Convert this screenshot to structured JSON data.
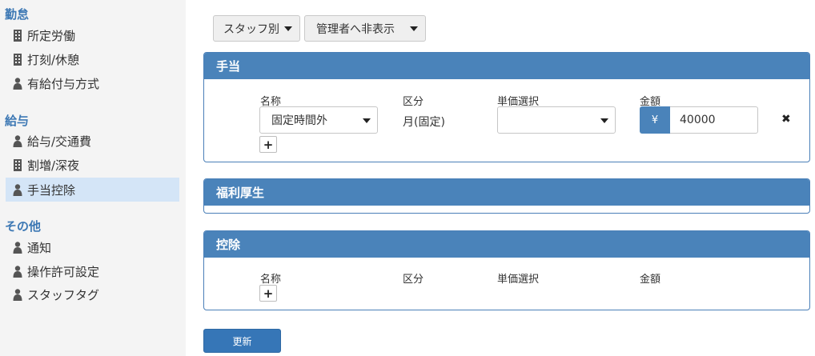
{
  "sidebar": {
    "sections": [
      {
        "title": "勤怠",
        "items": [
          {
            "label": "所定労働",
            "icon": "building-icon"
          },
          {
            "label": "打刻/休憩",
            "icon": "building-icon"
          },
          {
            "label": "有給付与方式",
            "icon": "user-icon"
          }
        ]
      },
      {
        "title": "給与",
        "items": [
          {
            "label": "給与/交通費",
            "icon": "user-icon"
          },
          {
            "label": "割増/深夜",
            "icon": "building-icon"
          },
          {
            "label": "手当控除",
            "icon": "user-icon",
            "active": true
          }
        ]
      },
      {
        "title": "その他",
        "items": [
          {
            "label": "通知",
            "icon": "user-icon"
          },
          {
            "label": "操作許可設定",
            "icon": "user-icon"
          },
          {
            "label": "スタッフタグ",
            "icon": "user-icon"
          }
        ]
      }
    ]
  },
  "toolbar": {
    "staff_select": "スタッフ別",
    "visibility_select": "管理者へ非表示"
  },
  "allowance": {
    "title": "手当",
    "columns": {
      "name": "名称",
      "category": "区分",
      "unit_price": "単価選択",
      "amount": "金額"
    },
    "row": {
      "name_value": "固定時間外",
      "category_value": "月(固定)",
      "unit_price_value": "",
      "currency": "¥",
      "amount_value": "40000",
      "remove": "✖"
    },
    "add": "+"
  },
  "welfare": {
    "title": "福利厚生"
  },
  "deduction": {
    "title": "控除",
    "columns": {
      "name": "名称",
      "category": "区分",
      "unit_price": "単価選択",
      "amount": "金額"
    },
    "add": "+"
  },
  "actions": {
    "update": "更新"
  },
  "colors": {
    "accent": "#4a83ba",
    "active_bg": "#d4e5f7",
    "sidebar_bg": "#f4f4f4"
  }
}
